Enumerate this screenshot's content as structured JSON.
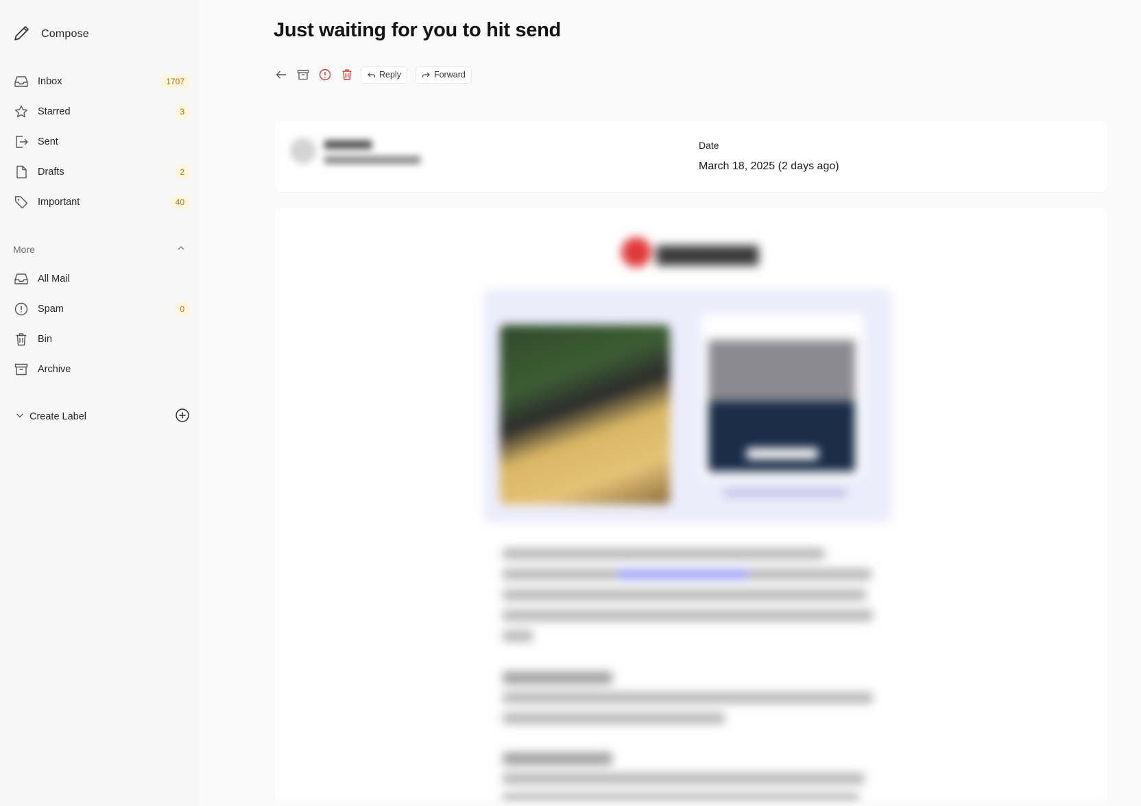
{
  "sidebar": {
    "compose_label": "Compose",
    "items": [
      {
        "label": "Inbox",
        "count": "1707"
      },
      {
        "label": "Starred",
        "count": "3"
      },
      {
        "label": "Sent",
        "count": ""
      },
      {
        "label": "Drafts",
        "count": "2"
      },
      {
        "label": "Important",
        "count": "40"
      }
    ],
    "more_label": "More",
    "more_items": [
      {
        "label": "All Mail",
        "count": ""
      },
      {
        "label": "Spam",
        "count": "0"
      },
      {
        "label": "Bin",
        "count": ""
      },
      {
        "label": "Archive",
        "count": ""
      }
    ],
    "create_label": "Create Label"
  },
  "email": {
    "subject": "Just waiting for you to hit send",
    "toolbar": {
      "reply_label": "Reply",
      "forward_label": "Forward"
    },
    "date_label": "Date",
    "date_value": "March 18, 2025 (2 days ago)"
  },
  "colors": {
    "badge_bg": "#fdf6dc",
    "badge_text": "#a8741a",
    "danger": "#d63b3b"
  }
}
